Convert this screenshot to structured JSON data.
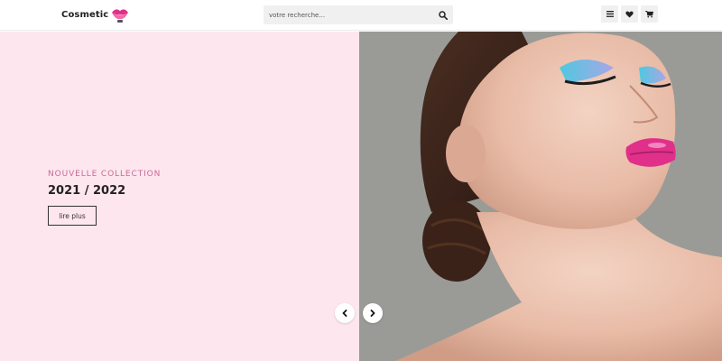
{
  "header": {
    "logo_text": "Cosmetic",
    "search": {
      "placeholder": "votre recherche...",
      "value": ""
    },
    "icons": {
      "search": "search-icon",
      "menu": "menu-icon",
      "wishlist": "heart-icon",
      "cart": "cart-icon"
    }
  },
  "hero": {
    "eyebrow": "NOUVELLE COLLECTION",
    "title": "2021 / 2022",
    "cta_label": "lire plus",
    "image": "woman-pink-lipstick-portrait",
    "nav": {
      "prev": "chevron-left-icon",
      "next": "chevron-right-icon"
    }
  },
  "colors": {
    "hero_left_bg": "#fde6ee",
    "accent_pink": "#c86c94",
    "photo_bg": "#9a9b97",
    "lip_pink": "#e0308a",
    "eyeshadow_cyan": "#4fc8e0"
  }
}
